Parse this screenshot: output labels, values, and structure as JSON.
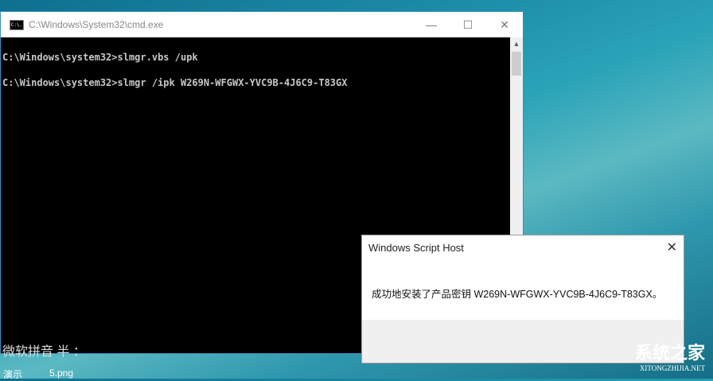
{
  "cmd": {
    "title": "C:\\Windows\\System32\\cmd.exe",
    "icon_text": "C:\\.",
    "minimize": "—",
    "maximize": "☐",
    "close": "✕",
    "lines": [
      "C:\\Windows\\system32>slmgr.vbs /upk",
      "C:\\Windows\\system32>slmgr /ipk W269N-WFGWX-YVC9B-4J6C9-T83GX"
    ],
    "ime_status": "微软拼音 半 ："
  },
  "desktop": {
    "items": [
      "演示",
      "5.png"
    ]
  },
  "dialog": {
    "title": "Windows Script Host",
    "close": "✕",
    "message": "成功地安装了产品密钥 W269N-WFGWX-YVC9B-4J6C9-T83GX。"
  },
  "watermark": {
    "main": "系统之家",
    "sub": "XITONGZHIJIA.NET"
  }
}
